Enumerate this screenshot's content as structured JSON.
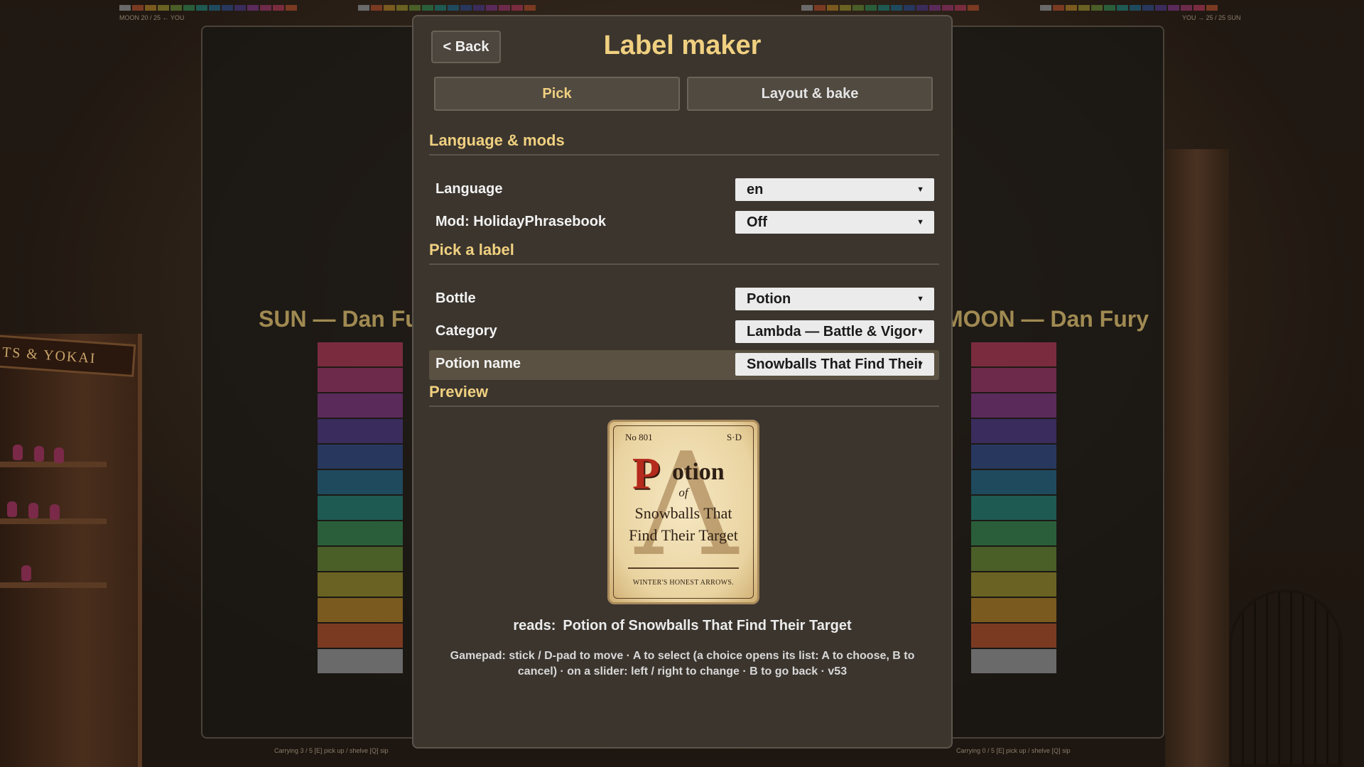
{
  "hud": {
    "left_caption": "MOON 20 / 25  ← YOU",
    "right_caption": "YOU →  25 / 25 SUN",
    "footer_left": "Carrying 3 / 5  [E] pick up / shelve  [Q] sip",
    "footer_right": "Carrying 0 / 5  [E] pick up / shelve  [Q] sip"
  },
  "scene": {
    "shelf_sign": "TS & YOKAI",
    "left_panel_title": "SUN — Dan Fury",
    "right_panel_title": "MOON — Dan Fury"
  },
  "dialog": {
    "back_label": "< Back",
    "title": "Label maker",
    "tabs": [
      {
        "label": "Pick",
        "active": true
      },
      {
        "label": "Layout & bake",
        "active": false
      }
    ],
    "sections": {
      "language_mods": "Language & mods",
      "pick_label": "Pick a label",
      "preview": "Preview"
    },
    "rows": {
      "language": {
        "label": "Language",
        "value": "en"
      },
      "mod": {
        "label": "Mod: HolidayPhrasebook",
        "value": "Off"
      },
      "bottle": {
        "label": "Bottle",
        "value": "Potion"
      },
      "category": {
        "label": "Category",
        "value": "Lambda — Battle & Vigor"
      },
      "potion_name": {
        "label": "Potion name",
        "value": "Snowballs That Find Their Target"
      }
    },
    "label_preview": {
      "number": "No 801",
      "maker": "S·D",
      "big_letter": "P",
      "word_rest": "otion",
      "of": "of",
      "name_line1": "Snowballs That",
      "name_line2": "Find Their Target",
      "tagline": "WINTER'S HONEST ARROWS.",
      "watermark": "Λ"
    },
    "reads_prefix": "reads:",
    "reads_text": "Potion of Snowballs That Find Their Target",
    "help_line1": "Gamepad: stick / D-pad to move  ·  A to select (a choice opens its list: A to choose, B to",
    "help_line2": "cancel)  ·  on a slider: left / right to change  ·  B to go back  ·  v53"
  },
  "colors": {
    "accent": "#f0d080",
    "dialog_bg": "#3b352e",
    "stack": [
      "#7a2c3e",
      "#6e2a4a",
      "#5a2a5a",
      "#3a2c5c",
      "#27375e",
      "#1f4a5e",
      "#1e5a52",
      "#2a5e3a",
      "#4a5e28",
      "#6a6222",
      "#7a5a1e",
      "#7a3a22",
      "#6a6a6a"
    ]
  }
}
